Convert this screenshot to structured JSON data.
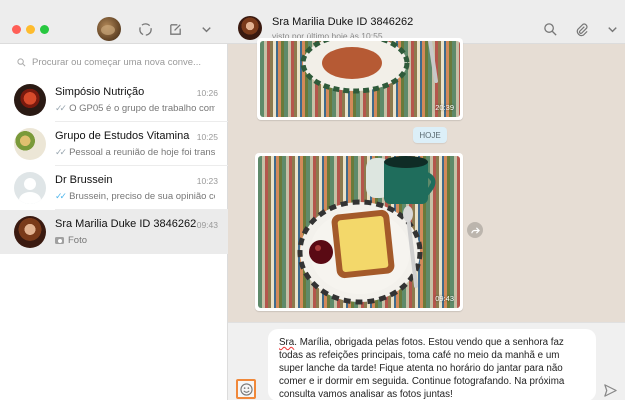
{
  "sidebar": {
    "search_placeholder": "Procurar ou começar uma nova conve...",
    "chats": [
      {
        "name": "Simpósio Nutrição",
        "time": "10:26",
        "preview": "O GP05 é o grupo de trabalho com ...",
        "ticks": "grey",
        "avatar": "red-dish"
      },
      {
        "name": "Grupo de Estudos Vitamina",
        "time": "10:25",
        "preview": "Pessoal a reunião de hoje foi transf...",
        "ticks": "grey",
        "avatar": "food-plate"
      },
      {
        "name": "Dr Brussein",
        "time": "10:23",
        "preview": "Brussein, preciso de sua opinião co...",
        "ticks": "blue",
        "avatar": "default-user"
      },
      {
        "name": "Sra Marilia Duke ID 3846262",
        "time": "09:43",
        "preview": "Foto",
        "ticks": "none",
        "avatar": "woman"
      }
    ]
  },
  "conversation": {
    "contact_name": "Sra Marilia Duke ID 3846262",
    "status": "visto por último hoje às 10:55",
    "messages": [
      {
        "type": "photo",
        "time": "20:39"
      },
      {
        "type": "date",
        "label": "HOJE"
      },
      {
        "type": "photo",
        "time": "09:43"
      }
    ]
  },
  "composer": {
    "first_word": "Sra",
    "text": ". Marília, obrigada pelas fotos. Estou vendo que a senhora faz todas as refeições principais, toma café no meio da manhã e um super lanche da tarde! Fique atenta no horário do jantar para não comer e ir dormir em seguida. Continue fotografando. Na próxima consulta vamos analisar as fotos juntas!"
  },
  "icons": [
    "status-icon",
    "new-chat-icon",
    "menu-chevron-icon",
    "search-icon",
    "attach-icon",
    "emoji-icon",
    "send-icon",
    "forward-icon"
  ],
  "colors": {
    "accent_highlight": "#f0883a",
    "chat_bg": "#e6ddd4",
    "date_chip": "#dceff8",
    "read_ticks": "#4fb6ec"
  }
}
